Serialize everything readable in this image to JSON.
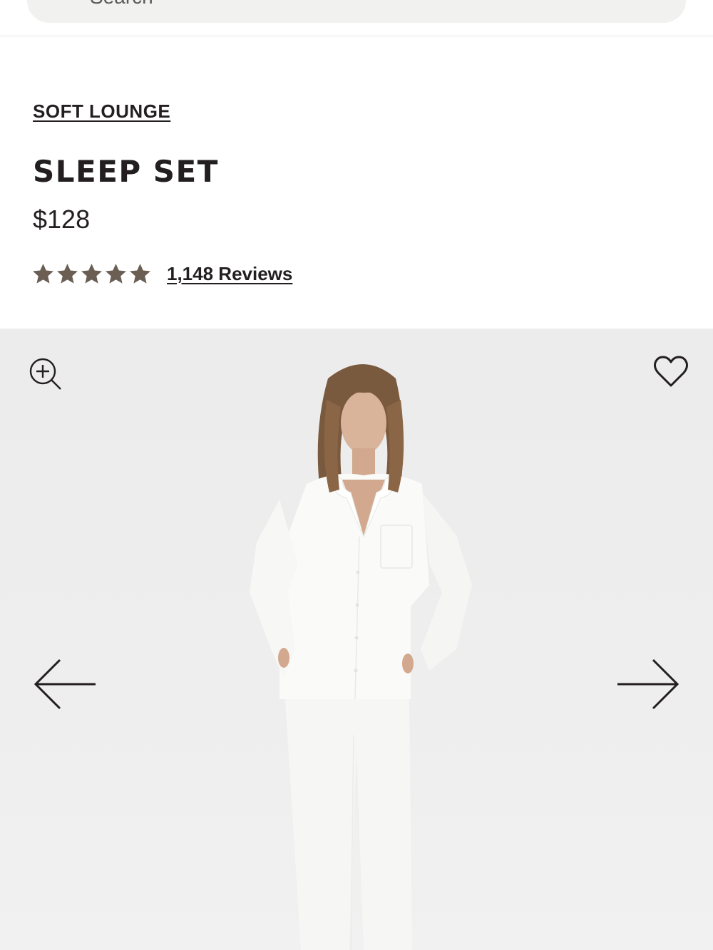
{
  "header": {
    "search": {
      "placeholder": "Search",
      "icon": "search-icon"
    }
  },
  "product": {
    "collection": "SOFT LOUNGE",
    "title": "SLEEP SET",
    "price": "$128",
    "rating": {
      "stars": 5,
      "reviews_label": "1,148 Reviews"
    }
  },
  "gallery": {
    "zoom_icon": "zoom-in-icon",
    "wishlist_icon": "heart-icon",
    "prev_icon": "arrow-left-icon",
    "next_icon": "arrow-right-icon",
    "image_alt": "Model wearing white long-sleeve pajama shirt and pants"
  },
  "colors": {
    "text": "#231f20",
    "star": "#6b5e53",
    "gallery_bg": "#ececec",
    "search_bg": "#f1f1f0"
  }
}
